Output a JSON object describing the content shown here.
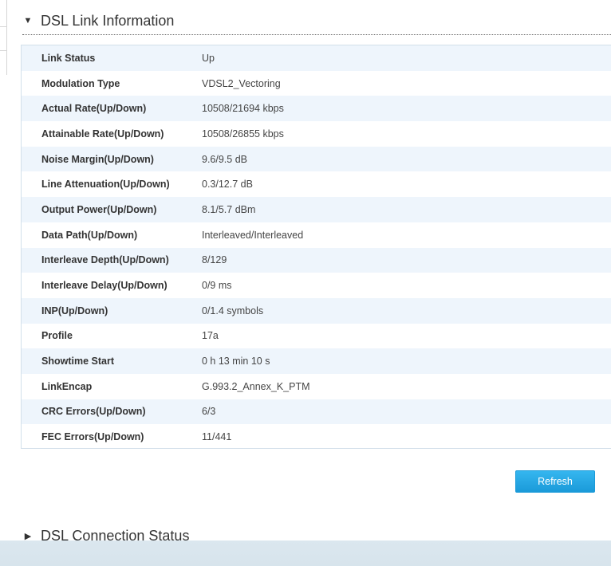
{
  "link_section": {
    "title": "DSL Link Information",
    "expanded": true,
    "rows": [
      {
        "label": "Link Status",
        "value": "Up"
      },
      {
        "label": "Modulation Type",
        "value": "VDSL2_Vectoring"
      },
      {
        "label": "Actual Rate(Up/Down)",
        "value": "10508/21694 kbps"
      },
      {
        "label": "Attainable Rate(Up/Down)",
        "value": "10508/26855 kbps"
      },
      {
        "label": "Noise Margin(Up/Down)",
        "value": "9.6/9.5 dB"
      },
      {
        "label": "Line Attenuation(Up/Down)",
        "value": "0.3/12.7 dB"
      },
      {
        "label": "Output Power(Up/Down)",
        "value": "8.1/5.7 dBm"
      },
      {
        "label": "Data Path(Up/Down)",
        "value": "Interleaved/Interleaved"
      },
      {
        "label": "Interleave Depth(Up/Down)",
        "value": "8/129"
      },
      {
        "label": "Interleave Delay(Up/Down)",
        "value": "0/9 ms"
      },
      {
        "label": "INP(Up/Down)",
        "value": "0/1.4 symbols"
      },
      {
        "label": "Profile",
        "value": "17a"
      },
      {
        "label": "Showtime Start",
        "value": "0 h 13 min 10 s"
      },
      {
        "label": "LinkEncap",
        "value": "G.993.2_Annex_K_PTM"
      },
      {
        "label": "CRC Errors(Up/Down)",
        "value": "6/3"
      },
      {
        "label": "FEC Errors(Up/Down)",
        "value": "11/441"
      }
    ]
  },
  "actions": {
    "refresh_label": "Refresh"
  },
  "connection_section": {
    "title": "DSL Connection Status",
    "expanded": false
  },
  "icons": {
    "expanded": "triangle-down-icon",
    "collapsed": "triangle-right-icon"
  },
  "colors": {
    "row_stripe": "#eef5fc",
    "panel_border": "#d2dfea",
    "button": "#1a9ad9",
    "bottom_band": "#d9e6ee"
  }
}
